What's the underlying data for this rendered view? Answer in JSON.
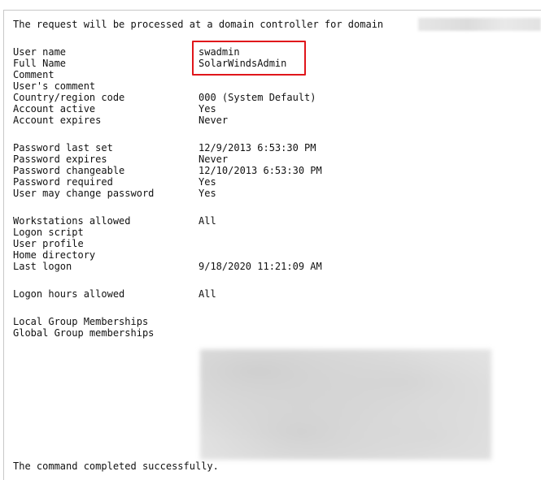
{
  "header": "The request will be processed at a domain controller for domain",
  "user_name": {
    "label": "User name",
    "value": "swadmin"
  },
  "full_name": {
    "label": "Full Name",
    "value": "SolarWindsAdmin"
  },
  "comment": {
    "label": "Comment"
  },
  "users_comment": {
    "label": "User's comment"
  },
  "country_code": {
    "label": "Country/region code",
    "value": "000 (System Default)"
  },
  "account_active": {
    "label": "Account active",
    "value": "Yes"
  },
  "account_expires": {
    "label": "Account expires",
    "value": "Never"
  },
  "password_last_set": {
    "label": "Password last set",
    "value": "12/9/2013 6:53:30 PM"
  },
  "password_expires": {
    "label": "Password expires",
    "value": "Never"
  },
  "password_changeable": {
    "label": "Password changeable",
    "value": "12/10/2013 6:53:30 PM"
  },
  "password_required": {
    "label": "Password required",
    "value": "Yes"
  },
  "user_may_change": {
    "label": "User may change password",
    "value": "Yes"
  },
  "workstations": {
    "label": "Workstations allowed",
    "value": "All"
  },
  "logon_script": {
    "label": "Logon script"
  },
  "user_profile": {
    "label": "User profile"
  },
  "home_directory": {
    "label": "Home directory"
  },
  "last_logon": {
    "label": "Last logon",
    "value": "9/18/2020 11:21:09 AM"
  },
  "logon_hours": {
    "label": "Logon hours allowed",
    "value": "All"
  },
  "local_groups": {
    "label": "Local Group Memberships"
  },
  "global_groups": {
    "label": "Global Group memberships"
  },
  "footer": "The command completed successfully.",
  "colors": {
    "highlight_border": "#e0161b",
    "text": "#111111",
    "background": "#ffffff"
  }
}
